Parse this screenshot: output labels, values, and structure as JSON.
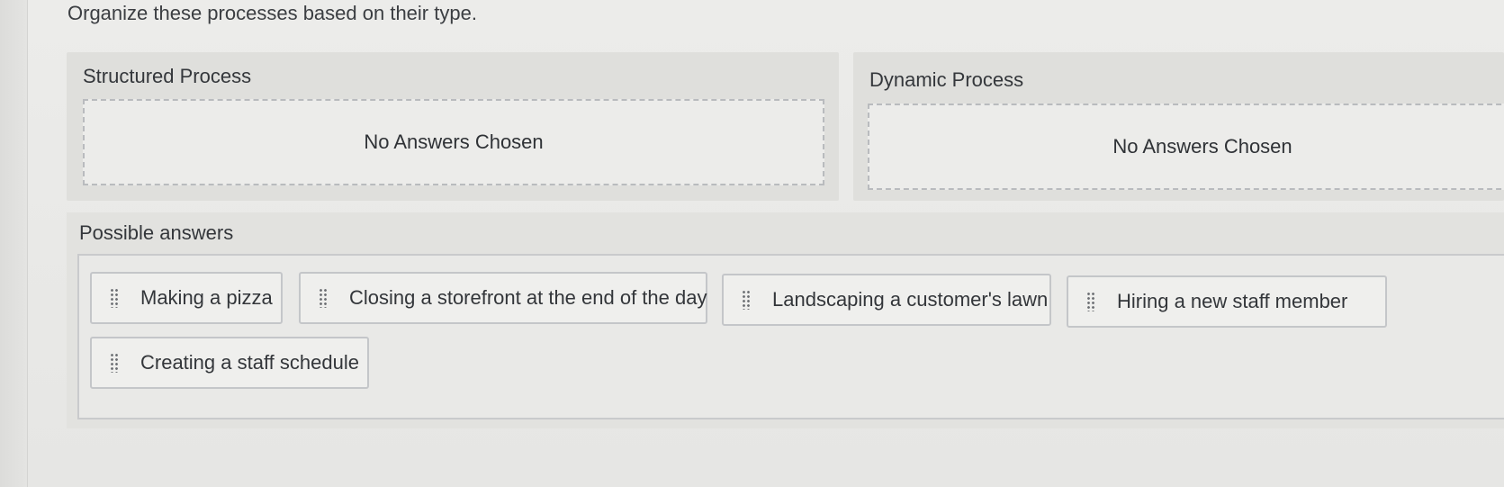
{
  "prompt": "Organize these processes based on their type.",
  "categories": [
    {
      "title": "Structured Process",
      "empty_text": "No Answers Chosen"
    },
    {
      "title": "Dynamic Process",
      "empty_text": "No Answers Chosen"
    }
  ],
  "possible_answers": {
    "title": "Possible answers",
    "items": [
      {
        "label": "Making a pizza"
      },
      {
        "label": "Closing a storefront at the end of the day"
      },
      {
        "label": "Landscaping a customer's lawn"
      },
      {
        "label": "Hiring a new staff member"
      },
      {
        "label": "Creating a staff schedule"
      }
    ]
  },
  "icons": {
    "drag_handle": "drag-handle-icon"
  }
}
